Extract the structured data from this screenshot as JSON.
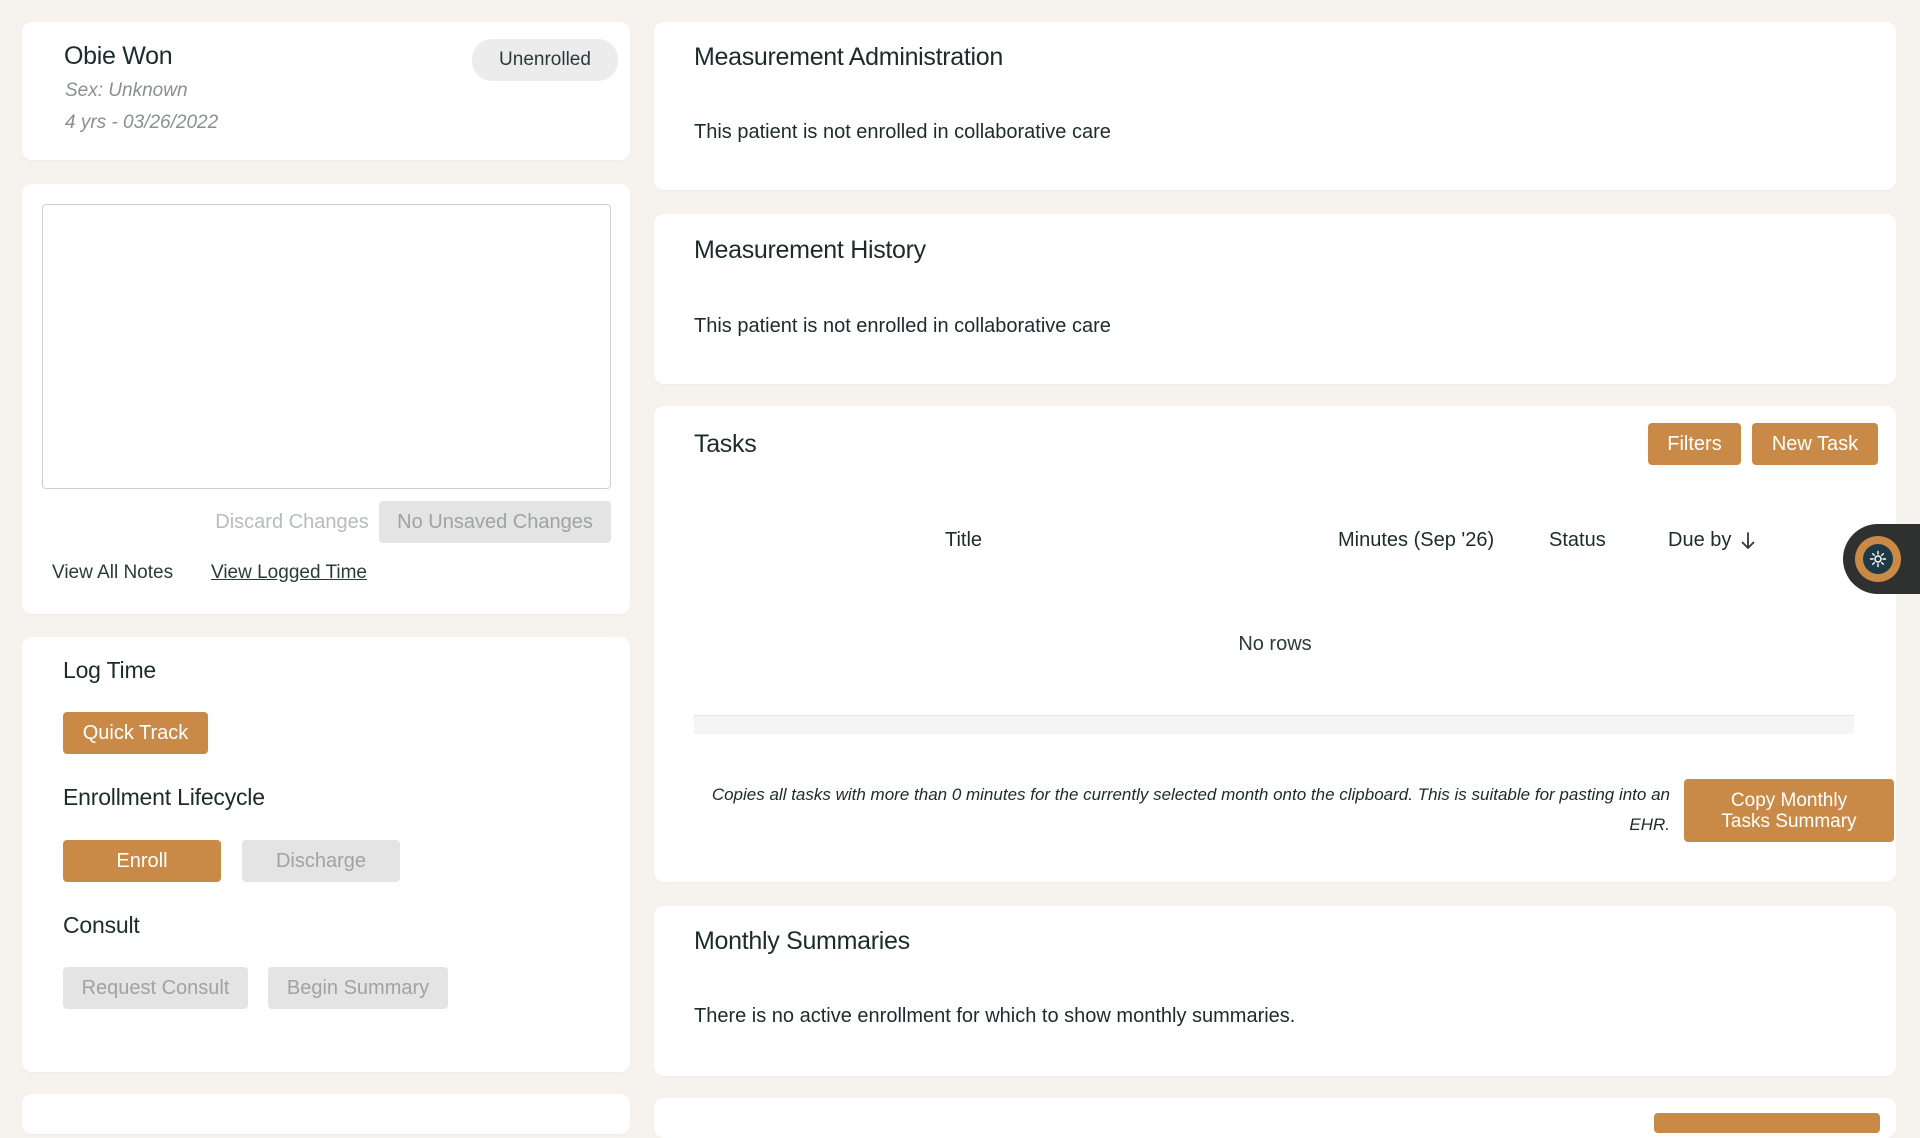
{
  "patient": {
    "name": "Obie Won",
    "sex": "Sex: Unknown",
    "age_dob": "4 yrs - 03/26/2022",
    "status_badge": "Unenrolled"
  },
  "notes": {
    "discard_label": "Discard Changes",
    "save_label": "No Unsaved Changes",
    "view_all_notes": "View All Notes",
    "view_logged_time": "View Logged Time"
  },
  "actions": {
    "log_time_title": "Log Time",
    "quick_track_label": "Quick Track",
    "enrollment_title": "Enrollment Lifecycle",
    "enroll_label": "Enroll",
    "discharge_label": "Discharge",
    "consult_title": "Consult",
    "request_consult_label": "Request Consult",
    "begin_summary_label": "Begin Summary"
  },
  "measurement_admin": {
    "title": "Measurement Administration",
    "message": "This patient is not enrolled in collaborative care"
  },
  "measurement_history": {
    "title": "Measurement History",
    "message": "This patient is not enrolled in collaborative care"
  },
  "tasks": {
    "title": "Tasks",
    "filters_label": "Filters",
    "new_task_label": "New Task",
    "columns": {
      "title": "Title",
      "minutes": "Minutes (Sep '26)",
      "status": "Status",
      "due_by": "Due by"
    },
    "empty_message": "No rows",
    "copy_note": "Copies all tasks with more than 0 minutes for the currently selected month onto the clipboard. This is suitable for pasting into an EHR.",
    "copy_label": "Copy Monthly Tasks Summary"
  },
  "monthly_summaries": {
    "title": "Monthly Summaries",
    "message": "There is no active enrollment for which to show monthly summaries."
  },
  "icons": {
    "sort": "arrow-down-icon",
    "assistant": "assistant-widget-icon"
  },
  "colors": {
    "accent": "#c98a48",
    "page_bg": "#f6f3ef",
    "card_bg": "#ffffff",
    "disabled_bg": "#e4e4e4",
    "disabled_text": "#9ea3a3"
  }
}
